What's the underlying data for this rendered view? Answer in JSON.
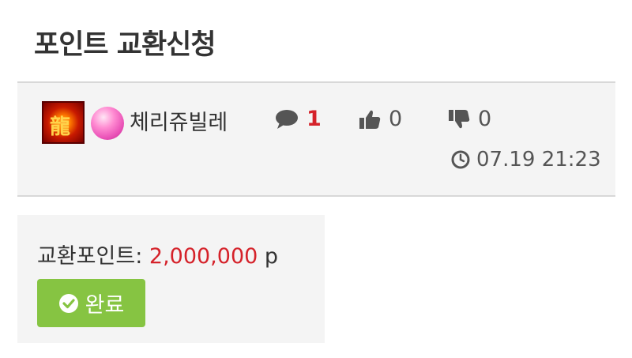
{
  "page": {
    "title": "포인트 교환신청"
  },
  "post_meta": {
    "author": "체리쥬빌레",
    "level_icon": "dragon-level-icon",
    "rank_icon": "pink-gem-icon",
    "comments": "1",
    "likes": "0",
    "dislikes": "0",
    "timestamp": "07.19 21:23"
  },
  "exchange": {
    "label": "교환포인트:",
    "points": "2,000,000",
    "unit": "p",
    "status_label": "완료"
  },
  "colors": {
    "accent_red": "#d5222a",
    "status_green": "#86c442",
    "panel_bg": "#f4f4f4"
  }
}
